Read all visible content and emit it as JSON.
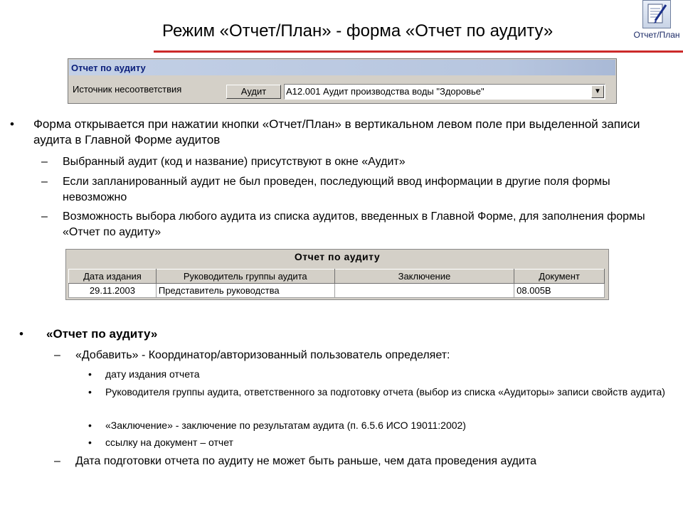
{
  "slide": {
    "title": "Режим «Отчет/План» - форма «Отчет по аудиту»",
    "app_button_label": "Отчет/План",
    "colors": {
      "rule": "#cc2a2a",
      "window_bg": "#d4d0c8",
      "window_title_text": "#0a1e7a"
    }
  },
  "window1": {
    "title": "Отчет по аудиту",
    "field_label": "Источник несоответствия",
    "button_label": "Аудит",
    "combo_value": "А12.001 Аудит производства воды \"Здоровье\""
  },
  "section1": {
    "bullet": "Форма открывается при нажатии кнопки «Отчет/План» в вертикальном левом поле при выделенной записи аудита в Главной Форме аудитов",
    "subs": [
      "Выбранный аудит (код и название) присутствуют в окне «Аудит»",
      "Если запланированный аудит не был проведен,  последующий ввод информации в другие поля формы невозможно",
      "Возможность выбора любого аудита из списка аудитов, введенных в Главной Форме, для заполнения формы «Отчет по аудиту»"
    ]
  },
  "window2": {
    "title": "Отчет по аудиту",
    "columns": [
      "Дата издания",
      "Руководитель группы аудита",
      "Заключение",
      "Документ"
    ],
    "rows": [
      [
        "29.11.2003",
        "Представитель руководства",
        "",
        "08.005В"
      ]
    ]
  },
  "section2": {
    "heading": "«Отчет по аудиту»",
    "sub1": "«Добавить» - Координатор/авторизованный пользователь определяет:",
    "items": [
      "дату издания отчета",
      "Руководителя группы аудита, ответственного за подготовку отчета (выбор из списка «Аудиторы» записи свойств аудита)",
      "«Заключение» - заключение по результатам аудита (п.  6.5.6 ИСО 19011:2002)",
      "ссылку на документ – отчет"
    ],
    "sub2": "Дата подготовки отчета по аудиту не может быть раньше, чем дата проведения аудита"
  }
}
